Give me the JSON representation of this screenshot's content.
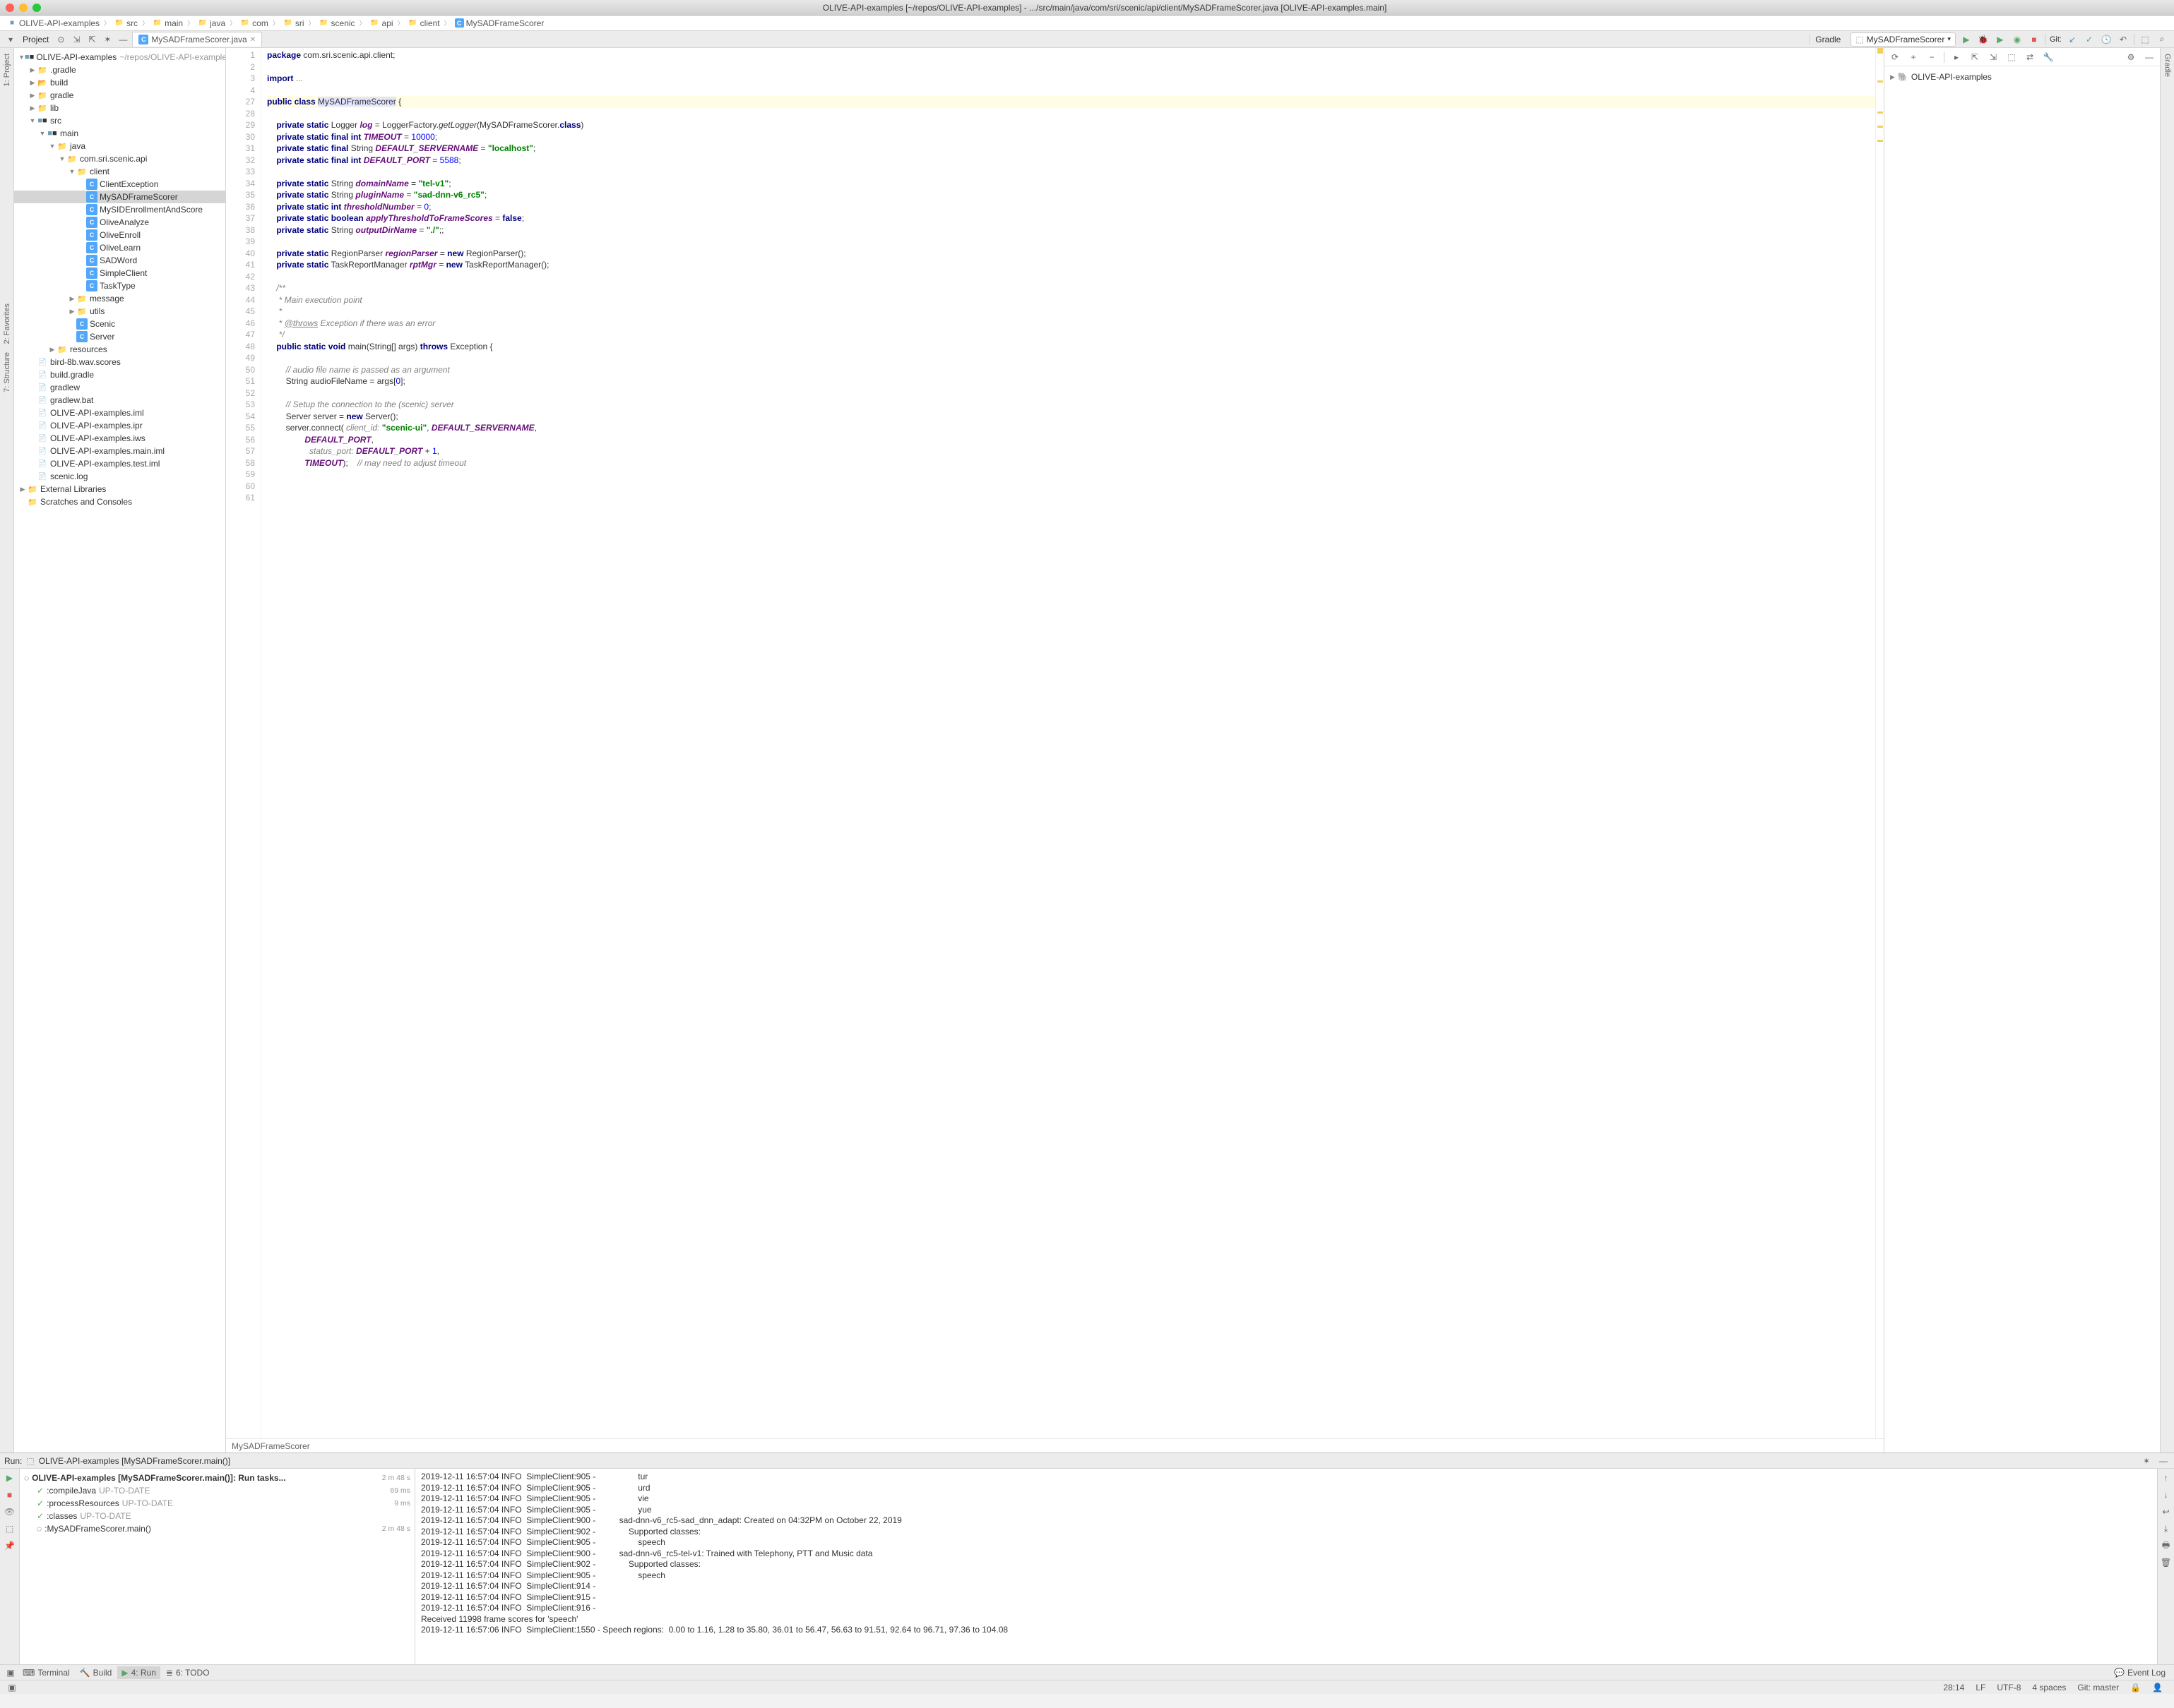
{
  "window": {
    "title": "OLIVE-API-examples [~/repos/OLIVE-API-examples] - .../src/main/java/com/sri/scenic/api/client/MySADFrameScorer.java [OLIVE-API-examples.main]"
  },
  "breadcrumbs": [
    "OLIVE-API-examples",
    "src",
    "main",
    "java",
    "com",
    "sri",
    "scenic",
    "api",
    "client",
    "MySADFrameScorer"
  ],
  "project_header": "Project",
  "editor_tab": "MySADFrameScorer.java",
  "gradle": {
    "title": "Gradle",
    "root": "OLIVE-API-examples"
  },
  "run_config": "MySADFrameScorer",
  "git_label": "Git:",
  "tree": [
    {
      "d": 0,
      "a": "v",
      "i": "mod",
      "t": "OLIVE-API-examples",
      "dim": "~/repos/OLIVE-API-examples"
    },
    {
      "d": 1,
      "a": ">",
      "i": "folder",
      "t": ".gradle"
    },
    {
      "d": 1,
      "a": ">",
      "i": "folder-o",
      "t": "build",
      "c": "#c88f4a"
    },
    {
      "d": 1,
      "a": ">",
      "i": "folder",
      "t": "gradle"
    },
    {
      "d": 1,
      "a": ">",
      "i": "folder",
      "t": "lib"
    },
    {
      "d": 1,
      "a": "v",
      "i": "mod",
      "t": "src"
    },
    {
      "d": 2,
      "a": "v",
      "i": "mod",
      "t": "main"
    },
    {
      "d": 3,
      "a": "v",
      "i": "folder",
      "t": "java",
      "c": "#6aa0e0"
    },
    {
      "d": 4,
      "a": "v",
      "i": "folder",
      "t": "com.sri.scenic.api"
    },
    {
      "d": 5,
      "a": "v",
      "i": "folder",
      "t": "client"
    },
    {
      "d": 6,
      "a": "",
      "i": "java",
      "t": "ClientException"
    },
    {
      "d": 6,
      "a": "",
      "i": "java",
      "t": "MySADFrameScorer",
      "sel": true
    },
    {
      "d": 6,
      "a": "",
      "i": "java",
      "t": "MySIDEnrollmentAndScore"
    },
    {
      "d": 6,
      "a": "",
      "i": "java",
      "t": "OliveAnalyze"
    },
    {
      "d": 6,
      "a": "",
      "i": "java",
      "t": "OliveEnroll"
    },
    {
      "d": 6,
      "a": "",
      "i": "java",
      "t": "OliveLearn"
    },
    {
      "d": 6,
      "a": "",
      "i": "java",
      "t": "SADWord"
    },
    {
      "d": 6,
      "a": "",
      "i": "java",
      "t": "SimpleClient"
    },
    {
      "d": 6,
      "a": "",
      "i": "java",
      "t": "TaskType"
    },
    {
      "d": 5,
      "a": ">",
      "i": "folder",
      "t": "message"
    },
    {
      "d": 5,
      "a": ">",
      "i": "folder",
      "t": "utils"
    },
    {
      "d": 5,
      "a": "",
      "i": "java",
      "t": "Scenic"
    },
    {
      "d": 5,
      "a": "",
      "i": "java",
      "t": "Server"
    },
    {
      "d": 3,
      "a": ">",
      "i": "folder",
      "t": "resources"
    },
    {
      "d": 1,
      "a": "",
      "i": "file",
      "t": "bird-8b.wav.scores"
    },
    {
      "d": 1,
      "a": "",
      "i": "file",
      "t": "build.gradle"
    },
    {
      "d": 1,
      "a": "",
      "i": "file",
      "t": "gradlew"
    },
    {
      "d": 1,
      "a": "",
      "i": "file",
      "t": "gradlew.bat"
    },
    {
      "d": 1,
      "a": "",
      "i": "file",
      "t": "OLIVE-API-examples.iml"
    },
    {
      "d": 1,
      "a": "",
      "i": "file",
      "t": "OLIVE-API-examples.ipr"
    },
    {
      "d": 1,
      "a": "",
      "i": "file",
      "t": "OLIVE-API-examples.iws"
    },
    {
      "d": 1,
      "a": "",
      "i": "file",
      "t": "OLIVE-API-examples.main.iml"
    },
    {
      "d": 1,
      "a": "",
      "i": "file",
      "t": "OLIVE-API-examples.test.iml"
    },
    {
      "d": 1,
      "a": "",
      "i": "file",
      "t": "scenic.log"
    },
    {
      "d": 0,
      "a": ">",
      "i": "folder",
      "t": "External Libraries"
    },
    {
      "d": 0,
      "a": "",
      "i": "folder",
      "t": "Scratches and Consoles"
    }
  ],
  "line_numbers": [
    "1",
    "2",
    "3",
    "4",
    "27",
    "28",
    "29",
    "30",
    "31",
    "32",
    "33",
    "34",
    "35",
    "36",
    "37",
    "38",
    "39",
    "40",
    "41",
    "42",
    "43",
    "44",
    "45",
    "46",
    "47",
    "48",
    "49",
    "50",
    "51",
    "52",
    "53",
    "54",
    "55",
    "56",
    "57",
    "58",
    "59",
    "60",
    "61"
  ],
  "code_lines": [
    {
      "h": "<span class='kw'>package</span> com.sri.scenic.api.client;"
    },
    {
      "h": ""
    },
    {
      "h": "<span class='kw'>import</span> <span class='ann'>...</span>"
    },
    {
      "h": ""
    },
    {
      "h": "<span class='kw'>public class</span> <span class='hlbox'>MySADFrameScorer</span> {",
      "hl": true
    },
    {
      "h": ""
    },
    {
      "h": "    <span class='kw'>private static</span> Logger <span class='field'>log</span> = LoggerFactory.<span style='font-style:italic'>getLogger</span>(MySADFrameScorer.<span class='kw'>class</span>)"
    },
    {
      "h": "    <span class='kw'>private static final int</span> <span class='field'>TIMEOUT</span> = <span class='num'>10000</span>;"
    },
    {
      "h": "    <span class='kw'>private static final</span> String <span class='field'>DEFAULT_SERVERNAME</span> = <span class='str'>\"localhost\"</span>;"
    },
    {
      "h": "    <span class='kw'>private static final int</span> <span class='field'>DEFAULT_PORT</span> = <span class='num'>5588</span>;"
    },
    {
      "h": ""
    },
    {
      "h": "    <span class='kw'>private static</span> String <span class='field'>domainName</span> = <span class='str'>\"tel-v1\"</span>;"
    },
    {
      "h": "    <span class='kw'>private static</span> String <span class='field'>pluginName</span> = <span class='str'>\"sad-dnn-v6_rc5\"</span>;"
    },
    {
      "h": "    <span class='kw'>private static int</span> <span class='field'>thresholdNumber</span> = <span class='num'>0</span>;"
    },
    {
      "h": "    <span class='kw'>private static boolean</span> <span class='field'>applyThresholdToFrameScores</span> = <span class='kw'>false</span>;"
    },
    {
      "h": "    <span class='kw'>private static</span> String <span class='field'>outputDirName</span> = <span class='str'>\"./\"</span>;;"
    },
    {
      "h": ""
    },
    {
      "h": "    <span class='kw'>private static</span> RegionParser <span class='field'>regionParser</span> = <span class='kw'>new</span> RegionParser();"
    },
    {
      "h": "    <span class='kw'>private static</span> TaskReportManager <span class='field'>rptMgr</span> = <span class='kw'>new</span> TaskReportManager();"
    },
    {
      "h": ""
    },
    {
      "h": "    <span class='doc'>/**</span>"
    },
    {
      "h": "    <span class='doc'> * Main execution point</span>"
    },
    {
      "h": "    <span class='doc'> *</span>"
    },
    {
      "h": "    <span class='doc'> * </span><span class='doclink'>@throws</span><span class='doc'> Exception if there was an error</span>"
    },
    {
      "h": "    <span class='doc'> */</span>"
    },
    {
      "h": "    <span class='kw'>public static void</span> main(String[] args) <span class='kw'>throws</span> Exception {"
    },
    {
      "h": ""
    },
    {
      "h": "        <span class='com'>// audio file name is passed as an argument</span>"
    },
    {
      "h": "        String audioFileName = args[<span class='num'>0</span>];"
    },
    {
      "h": ""
    },
    {
      "h": "        <span class='com'>// Setup the connection to the (scenic) server</span>"
    },
    {
      "h": "        Server server = <span class='kw'>new</span> Server();"
    },
    {
      "h": "        server.connect( <span class='com'>client_id:</span> <span class='str'>\"scenic-ui\"</span>, <span class='field'>DEFAULT_SERVERNAME</span>,"
    },
    {
      "h": "                <span class='field'>DEFAULT_PORT</span>,"
    },
    {
      "h": "                  <span class='com'>status_port:</span> <span class='field'>DEFAULT_PORT</span> + <span class='num'>1</span>,"
    },
    {
      "h": "                <span class='field'>TIMEOUT</span>);    <span class='com'>// may need to adjust timeout</span>"
    },
    {
      "h": ""
    },
    {
      "h": ""
    }
  ],
  "editor_breadcrumb": "MySADFrameScorer",
  "run": {
    "label": "Run:",
    "config": "OLIVE-API-examples [MySADFrameScorer.main()]",
    "root_task": "OLIVE-API-examples [MySADFrameScorer.main()]: Run tasks...",
    "root_time": "2 m 48 s",
    "tasks": [
      {
        "name": ":compileJava",
        "status": "UP-TO-DATE",
        "time": "69 ms"
      },
      {
        "name": ":processResources",
        "status": "UP-TO-DATE",
        "time": "9 ms"
      },
      {
        "name": ":classes",
        "status": "UP-TO-DATE",
        "time": ""
      },
      {
        "name": ":MySADFrameScorer.main()",
        "status": "",
        "time": "2 m 48 s",
        "spin": true
      }
    ]
  },
  "console": [
    "2019-12-11 16:57:04 INFO  SimpleClient:905 -                  tur",
    "2019-12-11 16:57:04 INFO  SimpleClient:905 -                  urd",
    "2019-12-11 16:57:04 INFO  SimpleClient:905 -                  vie",
    "2019-12-11 16:57:04 INFO  SimpleClient:905 -                  yue",
    "2019-12-11 16:57:04 INFO  SimpleClient:900 -          sad-dnn-v6_rc5-sad_dnn_adapt: Created on 04:32PM on October 22, 2019",
    "2019-12-11 16:57:04 INFO  SimpleClient:902 -              Supported classes:",
    "2019-12-11 16:57:04 INFO  SimpleClient:905 -                  speech",
    "2019-12-11 16:57:04 INFO  SimpleClient:900 -          sad-dnn-v6_rc5-tel-v1: Trained with Telephony, PTT and Music data",
    "2019-12-11 16:57:04 INFO  SimpleClient:902 -              Supported classes:",
    "2019-12-11 16:57:04 INFO  SimpleClient:905 -                  speech",
    "2019-12-11 16:57:04 INFO  SimpleClient:914 - ",
    "2019-12-11 16:57:04 INFO  SimpleClient:915 - ",
    "2019-12-11 16:57:04 INFO  SimpleClient:916 - ",
    "Received 11998 frame scores for 'speech'",
    "2019-12-11 16:57:06 INFO  SimpleClient:1550 - Speech regions:  0.00 to 1.16, 1.28 to 35.80, 36.01 to 56.47, 56.63 to 91.51, 92.64 to 96.71, 97.36 to 104.08"
  ],
  "bottom_tabs": {
    "terminal": "Terminal",
    "build": "Build",
    "run": "4: Run",
    "todo": "6: TODO",
    "eventlog": "Event Log"
  },
  "status": {
    "pos": "28:14",
    "le": "LF",
    "enc": "UTF-8",
    "indent": "4 spaces",
    "branch": "Git: master"
  },
  "side_tabs": {
    "project": "1: Project",
    "favorites": "2: Favorites",
    "structure": "7: Structure",
    "gradle": "Gradle"
  }
}
